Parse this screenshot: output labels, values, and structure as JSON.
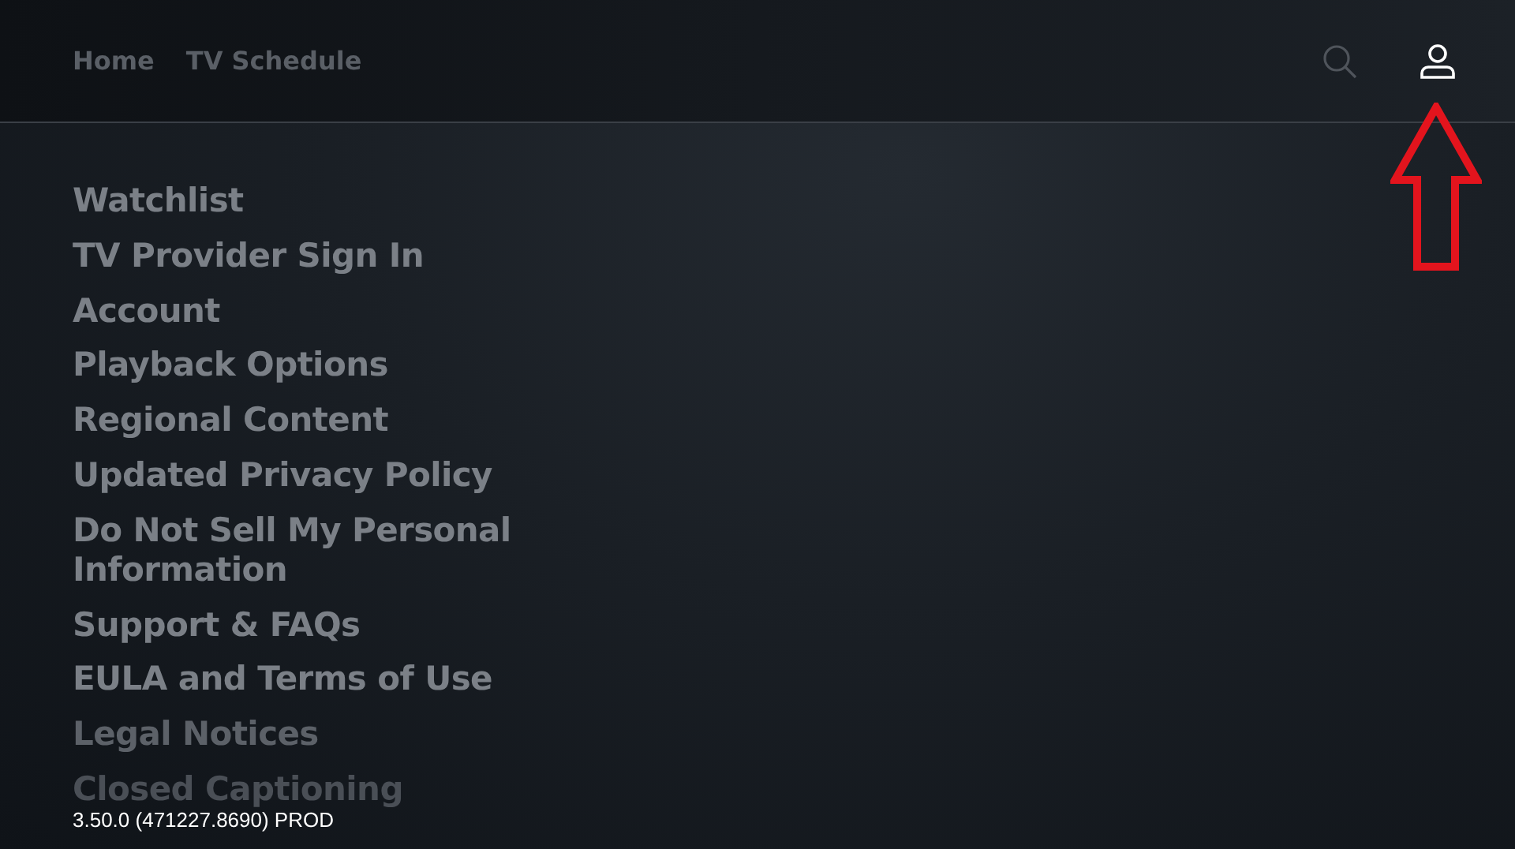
{
  "nav": {
    "links": [
      {
        "label": "Home",
        "selected": false
      },
      {
        "label": "TV Schedule",
        "selected": false
      }
    ],
    "icons": [
      {
        "kind": "search",
        "selected": false
      },
      {
        "kind": "profile",
        "selected": true
      }
    ]
  },
  "menu": [
    {
      "label": "Watchlist",
      "kind": "normal"
    },
    {
      "label": "TV Provider Sign In",
      "kind": "normal"
    },
    {
      "label": "Account",
      "kind": "normal"
    },
    {
      "label": "Playback Options",
      "kind": "normal"
    },
    {
      "label": "Regional Content",
      "kind": "normal"
    },
    {
      "label": "Updated Privacy Policy",
      "kind": "normal"
    },
    {
      "label": "Do Not Sell My Personal Information",
      "kind": "normal"
    },
    {
      "label": "Support & FAQs",
      "kind": "normal"
    },
    {
      "label": "EULA and Terms of Use",
      "kind": "normal"
    },
    {
      "label": "Legal Notices",
      "kind": "dim"
    },
    {
      "label": "Closed Captioning",
      "kind": "faded"
    }
  ],
  "version": "3.50.0 (471227.8690) PROD"
}
